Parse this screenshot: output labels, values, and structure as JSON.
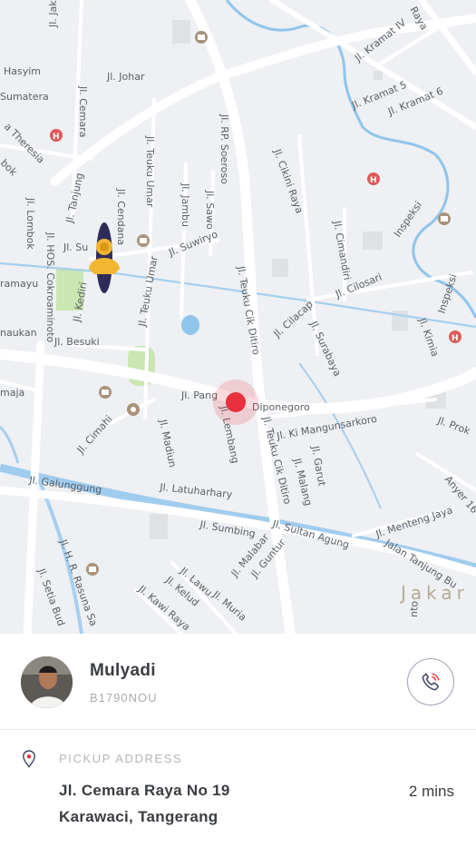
{
  "map": {
    "district_label": "Jakar",
    "road_labels": {
      "jaksa": "Jl. Jaksa",
      "kramat_iv": "Jl. Kramat IV",
      "raya": "Raya",
      "hasyim": "Hasyim",
      "johar": "Jl. Johar",
      "sumatera": "Sumatera",
      "cemara": "Jl. Cemara",
      "kramat5": "Jl. Kramat 5",
      "kramat6": "Jl. Kramat 6",
      "theresia": "a Theresia",
      "bok": "bok",
      "rp_soeroso": "Jl. RP. Soeroso",
      "cikini_raya": "Jl. Cikini Raya",
      "tanjung": "Jl. Tanjung",
      "cendana": "Jl. Cendana",
      "teuku_umar": "Jl. Teuku Umar",
      "jambu": "Jl. Jambu",
      "sawo": "Jl. Sawo",
      "lombok": "Jl. Lombok",
      "inspeksi1": "Inspeksi",
      "suwiryo": "Jl. Suwiryo",
      "cimandiri": "Jl. Cimandiri",
      "su": "Jl. Su",
      "ramayu": "ramayu",
      "hos_cokroaminoto": "Jl. HOS. Cokroaminoto",
      "kediri": "Jl. Kediri",
      "teuku_umar2": "Jl. Teuku Umar",
      "teuku_cik_ditiro": "Jl. Teuku Cik Ditiro",
      "cilosari": "Jl. Cilosari",
      "inspeksi2": "Inspeksi",
      "naukan": "naukan",
      "besuki": "Jl. Besuki",
      "cilacap": "Jl. Cilacap",
      "surabaya": "Jl. Surabaya",
      "kimia": "Jl. Kimia",
      "maja": "maja",
      "pang": "Jl. Pang",
      "diponegoro": "Diponegoro",
      "prok": "Jl. Prok",
      "cimahi": "Jl. Cimahi",
      "madiun": "Jl. Madiun",
      "lembang": "Jl. Lembang",
      "ki_mangunsarkoro": "Jl. Ki Mangunsarkoro",
      "garut": "Jl. Garut",
      "malang": "Jl. Malang",
      "teuku_cik_ditiro2": "Jl. Teuku Cik Ditiro",
      "galunggung": "Jl. Galunggung",
      "latuharhary": "Jl. Latuharhary",
      "anyer": "Anyer 16",
      "menteng_jaya": "Jl. Menteng Jaya",
      "sumbing": "Jl. Sumbing",
      "sultan_agung": "Jl. Sultan Agung",
      "jalan_tanjung": "Jalan Tanjung Bu",
      "malabar": "Jl. Malabar",
      "guntur": "Jl. Guntur",
      "hr_rasuna": "Jl. H. R. Rasuna Sa",
      "setia_bud": "Jl. Setia Bud",
      "lawu": "Jl. Lawu",
      "kelud": "Jl. Kelud",
      "kawi_raya": "Jl. Kawi Raya",
      "muria": "Jl. Muria",
      "into": "nto"
    }
  },
  "driver": {
    "name": "Mulyadi",
    "plate": "B1790NOU"
  },
  "pickup": {
    "label": "PICKUP ADDRESS",
    "address_line1": "Jl. Cemara Raya No 19",
    "address_line2": "Karawaci, Tangerang",
    "eta": "2 mins"
  },
  "colors": {
    "pin": "#e8313c",
    "river": "#8fc5ec",
    "park": "#c9e6b3",
    "motorbike_rider": "#f2b632",
    "icon_outline": "#9aa3b3"
  },
  "icons": {
    "call": "phone-icon",
    "pickup": "location-pin-icon",
    "hospital": "hospital-icon",
    "museum": "museum-icon",
    "mosque": "mosque-icon",
    "motorbike": "motorbike-icon"
  }
}
